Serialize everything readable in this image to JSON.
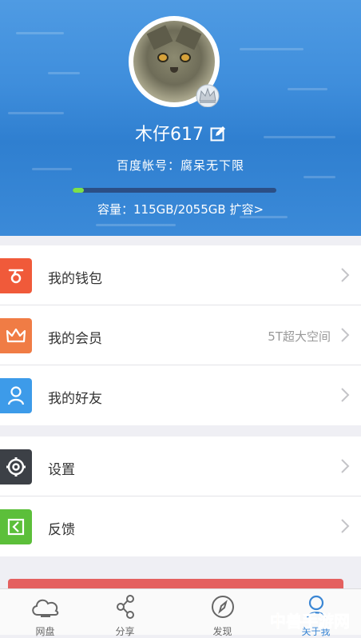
{
  "profile": {
    "username": "木仔617",
    "account": "百度帐号：腐呆无下限",
    "capacity": "容量：115GB/2055GB 扩容>",
    "usage_fraction": 0.056
  },
  "menu_group_1": [
    {
      "label": "我的钱包",
      "icon": "wallet-icon",
      "color": "#f05a3a",
      "extra": ""
    },
    {
      "label": "我的会员",
      "icon": "crown-icon",
      "color": "#f07c45",
      "extra": "5T超大空间"
    },
    {
      "label": "我的好友",
      "icon": "friend-icon",
      "color": "#3d9be9",
      "extra": ""
    }
  ],
  "menu_group_2": [
    {
      "label": "设置",
      "icon": "gear-icon",
      "color": "#3c4046",
      "extra": ""
    },
    {
      "label": "反馈",
      "icon": "feedback-icon",
      "color": "#5cbf3a",
      "extra": ""
    }
  ],
  "tabbar": {
    "tabs": [
      {
        "label": "网盘",
        "icon": "cloud-icon"
      },
      {
        "label": "分享",
        "icon": "share-icon"
      },
      {
        "label": "发现",
        "icon": "compass-icon"
      },
      {
        "label": "关于我",
        "icon": "person-icon"
      }
    ],
    "active": "关于我"
  },
  "watermark": "中兽手游网"
}
